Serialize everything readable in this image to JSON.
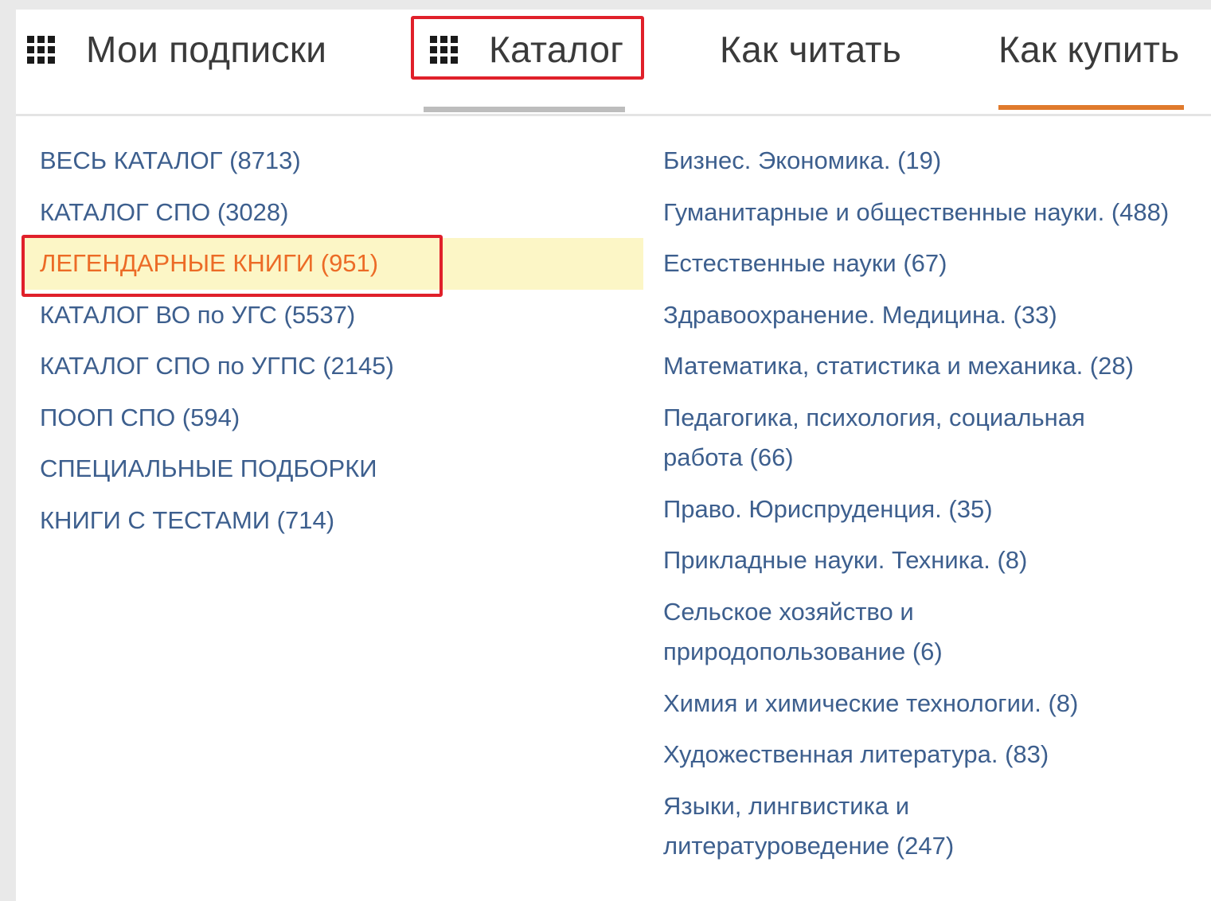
{
  "nav": {
    "tabs": [
      {
        "label": "Мои подписки",
        "icon": "apps-grid-icon"
      },
      {
        "label": "Каталог",
        "icon": "apps-grid-icon",
        "highlighted": true
      },
      {
        "label": "Как читать"
      },
      {
        "label": "Как купить",
        "active": true
      }
    ]
  },
  "menu": {
    "left_items": [
      "ВЕСЬ КАТАЛОГ (8713)",
      "КАТАЛОГ СПО (3028)",
      "ЛЕГЕНДАРНЫЕ КНИГИ (951)",
      "КАТАЛОГ ВО по УГС (5537)",
      "КАТАЛОГ СПО по УГПС (2145)",
      "ПООП СПО (594)",
      "СПЕЦИАЛЬНЫЕ ПОДБОРКИ",
      "КНИГИ С ТЕСТАМИ (714)"
    ],
    "active_left_index": 2,
    "right_items": [
      {
        "lines": [
          "Бизнес. Экономика. (19)"
        ]
      },
      {
        "lines": [
          "Гуманитарные и общественные науки. (488)"
        ]
      },
      {
        "lines": [
          "Естественные науки (67)"
        ]
      },
      {
        "lines": [
          "Здравоохранение. Медицина. (33)"
        ]
      },
      {
        "lines": [
          "Математика, статистика и механика. (28)"
        ]
      },
      {
        "lines": [
          "Педагогика, психология, социальная",
          "работа (66)"
        ]
      },
      {
        "lines": [
          "Право. Юриспруденция. (35)"
        ]
      },
      {
        "lines": [
          "Прикладные науки. Техника. (8)"
        ]
      },
      {
        "lines": [
          "Сельское хозяйство и",
          "природопользование (6)"
        ]
      },
      {
        "lines": [
          "Химия и химические технологии. (8)"
        ]
      },
      {
        "lines": [
          "Художественная литература. (83)"
        ]
      },
      {
        "lines": [
          "Языки, лингвистика и",
          "литературоведение (247)"
        ]
      }
    ]
  },
  "colors": {
    "link": "#3d5f8e",
    "active_text": "#ec6b26",
    "active_background": "#fcf6c6",
    "annotation_frame": "#e0202a",
    "tab_underline_orange": "#e07a2c",
    "tab_underline_gray": "#bdbdbd"
  }
}
